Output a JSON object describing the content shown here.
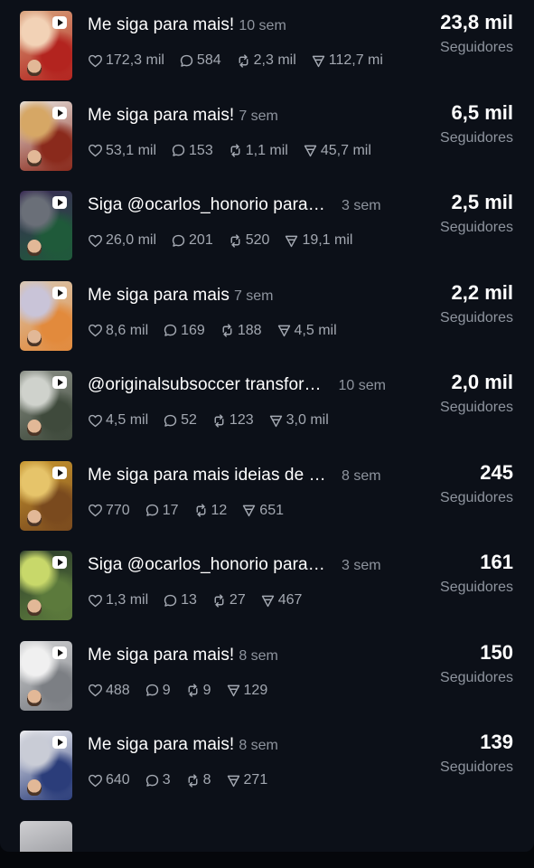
{
  "rows": [
    {
      "title": "Me siga para mais!",
      "age": "10 sem",
      "likes": "172,3 mil",
      "comments": "584",
      "reposts": "2,3 mil",
      "views": "112,7 mil",
      "followers": "23,8 mil",
      "followers_label": "Seguidores",
      "thumb_colors": [
        "#d8a37c",
        "#b3241f",
        "#f2d2b6"
      ]
    },
    {
      "title": "Me siga para mais!",
      "age": "7 sem",
      "likes": "53,1 mil",
      "comments": "153",
      "reposts": "1,1 mil",
      "views": "45,7 mil",
      "followers": "6,5 mil",
      "followers_label": "Seguidores",
      "thumb_colors": [
        "#e8e4e0",
        "#8a2a1c",
        "#d6a765"
      ]
    },
    {
      "title": "Siga @ocarlos_honorio para mais",
      "age": "3 sem",
      "likes": "26,0 mil",
      "comments": "201",
      "reposts": "520",
      "views": "19,1 mil",
      "followers": "2,5 mil",
      "followers_label": "Seguidores",
      "thumb_colors": [
        "#3a2a55",
        "#1f5a3a",
        "#6a6f78"
      ]
    },
    {
      "title": "Me siga para mais",
      "age": "7 sem",
      "likes": "8,6 mil",
      "comments": "169",
      "reposts": "188",
      "views": "4,5 mil",
      "followers": "2,2 mil",
      "followers_label": "Seguidores",
      "thumb_colors": [
        "#d9c7b0",
        "#e28a3c",
        "#c9c4d8"
      ]
    },
    {
      "title": "@originalsubsoccer transformou",
      "age": "10 sem",
      "likes": "4,5 mil",
      "comments": "52",
      "reposts": "123",
      "views": "3,0 mil",
      "followers": "2,0 mil",
      "followers_label": "Seguidores",
      "thumb_colors": [
        "#8a8f86",
        "#3f4a3c",
        "#cfd2cc"
      ]
    },
    {
      "title": "Me siga para mais ideias de receitas",
      "age": "8 sem",
      "likes": "770",
      "comments": "17",
      "reposts": "12",
      "views": "651",
      "followers": "245",
      "followers_label": "Seguidores",
      "thumb_colors": [
        "#c8962e",
        "#7a4a1e",
        "#e6c46a"
      ]
    },
    {
      "title": "Siga @ocarlos_honorio para mais",
      "age": "3 sem",
      "likes": "1,3 mil",
      "comments": "13",
      "reposts": "27",
      "views": "467",
      "followers": "161",
      "followers_label": "Seguidores",
      "thumb_colors": [
        "#2a3b2a",
        "#5c7a3c",
        "#c8d86a"
      ]
    },
    {
      "title": "Me siga para mais!",
      "age": "8 sem",
      "likes": "488",
      "comments": "9",
      "reposts": "9",
      "views": "129",
      "followers": "150",
      "followers_label": "Seguidores",
      "thumb_colors": [
        "#cfd0d2",
        "#7c7f84",
        "#f0f0f0"
      ]
    },
    {
      "title": "Me siga para mais!",
      "age": "8 sem",
      "likes": "640",
      "comments": "3",
      "reposts": "8",
      "views": "271",
      "followers": "139",
      "followers_label": "Seguidores",
      "thumb_colors": [
        "#f2f2f4",
        "#2b3d7a",
        "#c9ccd6"
      ]
    }
  ],
  "icons": {
    "likes": "heart-icon",
    "comments": "comment-icon",
    "reposts": "repost-icon",
    "views": "views-icon",
    "play": "play-icon"
  }
}
